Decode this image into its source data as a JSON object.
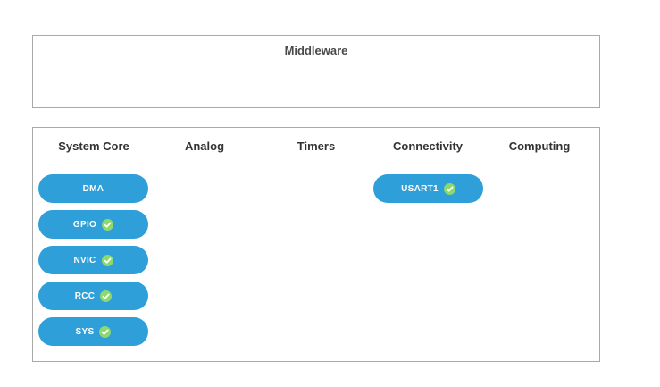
{
  "middleware": {
    "title": "Middleware"
  },
  "categories": {
    "system_core": "System Core",
    "analog": "Analog",
    "timers": "Timers",
    "connectivity": "Connectivity",
    "computing": "Computing"
  },
  "system_core_items": {
    "dma": {
      "label": "DMA",
      "configured": false
    },
    "gpio": {
      "label": "GPIO",
      "configured": true
    },
    "nvic": {
      "label": "NVIC",
      "configured": true
    },
    "rcc": {
      "label": "RCC",
      "configured": true
    },
    "sys": {
      "label": "SYS",
      "configured": true
    }
  },
  "connectivity_items": {
    "usart1": {
      "label": "USART1",
      "configured": true
    }
  },
  "colors": {
    "button_bg": "#2e9fd8",
    "check_fill": "#8ed96f",
    "check_mark": "#ffffff"
  },
  "icons": {
    "configured": "check-circle-icon"
  }
}
